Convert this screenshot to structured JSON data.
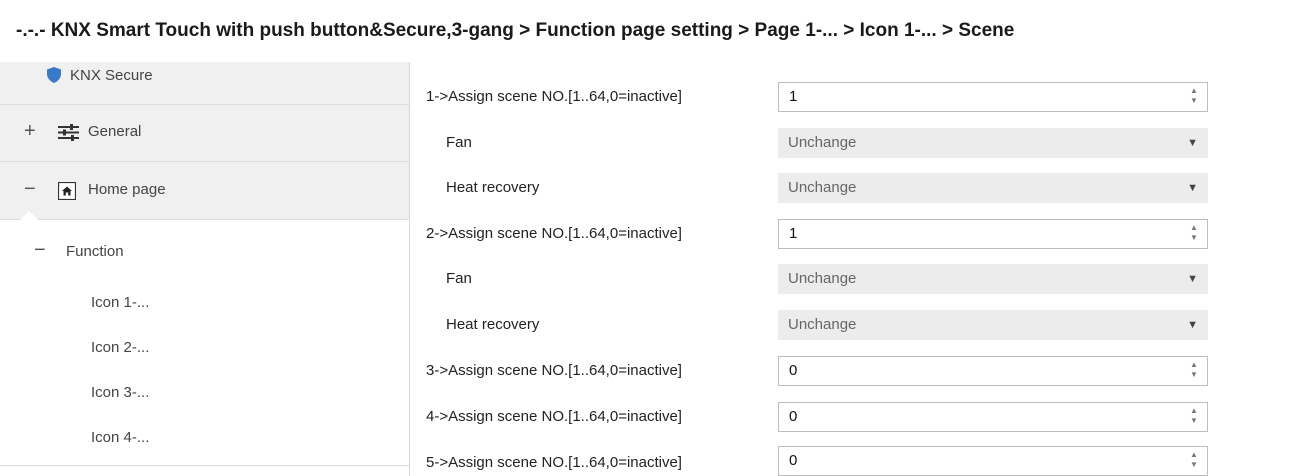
{
  "breadcrumb": "-.-.- KNX Smart Touch with push button&Secure,3-gang > Function page setting > Page 1-... > Icon 1-... > Scene",
  "sidebar": {
    "secure": "KNX Secure",
    "general": "General",
    "home": "Home page",
    "function": "Function",
    "icons": [
      "Icon 1-...",
      "Icon 2-...",
      "Icon 3-...",
      "Icon 4-..."
    ],
    "expand_glyph": "+",
    "collapse_glyph": "−"
  },
  "rows": {
    "scene1_label": "1->Assign scene NO.[1..64,0=inactive]",
    "scene1_value": "1",
    "fan1_label": "Fan",
    "fan1_value": "Unchange",
    "heat1_label": "Heat recovery",
    "heat1_value": "Unchange",
    "scene2_label": "2->Assign scene NO.[1..64,0=inactive]",
    "scene2_value": "1",
    "fan2_label": "Fan",
    "fan2_value": "Unchange",
    "heat2_label": "Heat recovery",
    "heat2_value": "Unchange",
    "scene3_label": "3->Assign scene NO.[1..64,0=inactive]",
    "scene3_value": "0",
    "scene4_label": "4->Assign scene NO.[1..64,0=inactive]",
    "scene4_value": "0",
    "scene5_label": "5->Assign scene NO.[1..64,0=inactive]",
    "scene5_value": "0"
  },
  "colors": {
    "shield": "#3a78c9",
    "sidebar_bg": "#f0f0f0",
    "combo_bg": "#ececec"
  }
}
